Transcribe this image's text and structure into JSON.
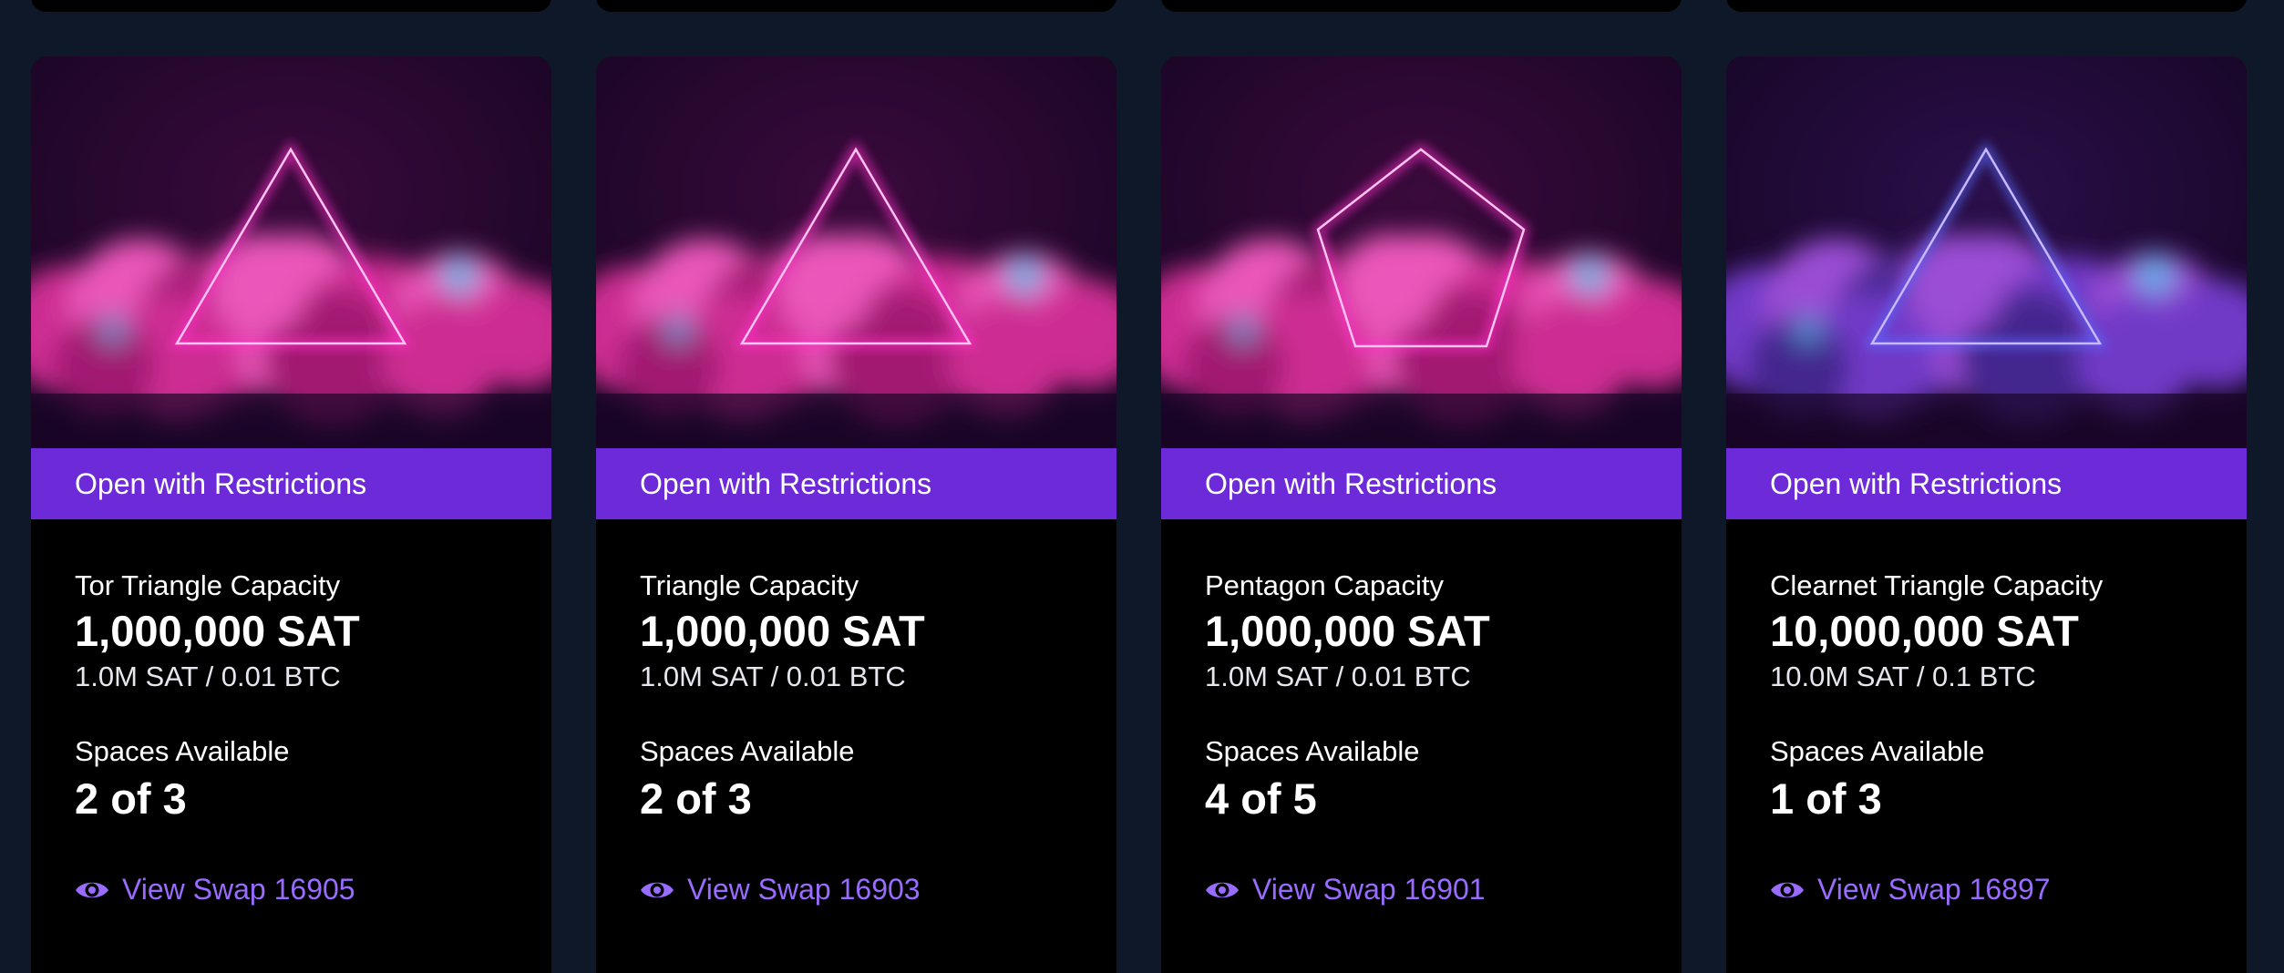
{
  "colors": {
    "page_background": "#0e1828",
    "card_background": "#000000",
    "status_bar": "#6d2ad8",
    "link": "#9a6bff",
    "neon_pink": "#ff2fc8",
    "neon_blue": "#5a6bff"
  },
  "cards": [
    {
      "art_shape": "triangle",
      "art_theme": "pink",
      "status": "Open with Restrictions",
      "capacity_label": "Tor Triangle Capacity",
      "capacity_value": "1,000,000 SAT",
      "capacity_sub": "1.0M SAT / 0.01 BTC",
      "spaces_label": "Spaces Available",
      "spaces_value": "2 of 3",
      "view_icon": "eye-icon",
      "view_label": "View Swap 16905"
    },
    {
      "art_shape": "triangle",
      "art_theme": "pink",
      "status": "Open with Restrictions",
      "capacity_label": "Triangle Capacity",
      "capacity_value": "1,000,000 SAT",
      "capacity_sub": "1.0M SAT / 0.01 BTC",
      "spaces_label": "Spaces Available",
      "spaces_value": "2 of 3",
      "view_icon": "eye-icon",
      "view_label": "View Swap 16903"
    },
    {
      "art_shape": "pentagon",
      "art_theme": "pink",
      "status": "Open with Restrictions",
      "capacity_label": "Pentagon Capacity",
      "capacity_value": "1,000,000 SAT",
      "capacity_sub": "1.0M SAT / 0.01 BTC",
      "spaces_label": "Spaces Available",
      "spaces_value": "4 of 5",
      "view_icon": "eye-icon",
      "view_label": "View Swap 16901"
    },
    {
      "art_shape": "triangle",
      "art_theme": "violet",
      "status": "Open with Restrictions",
      "capacity_label": "Clearnet Triangle Capacity",
      "capacity_value": "10,000,000 SAT",
      "capacity_sub": "10.0M SAT / 0.1 BTC",
      "spaces_label": "Spaces Available",
      "spaces_value": "1 of 3",
      "view_icon": "eye-icon",
      "view_label": "View Swap 16897"
    }
  ]
}
